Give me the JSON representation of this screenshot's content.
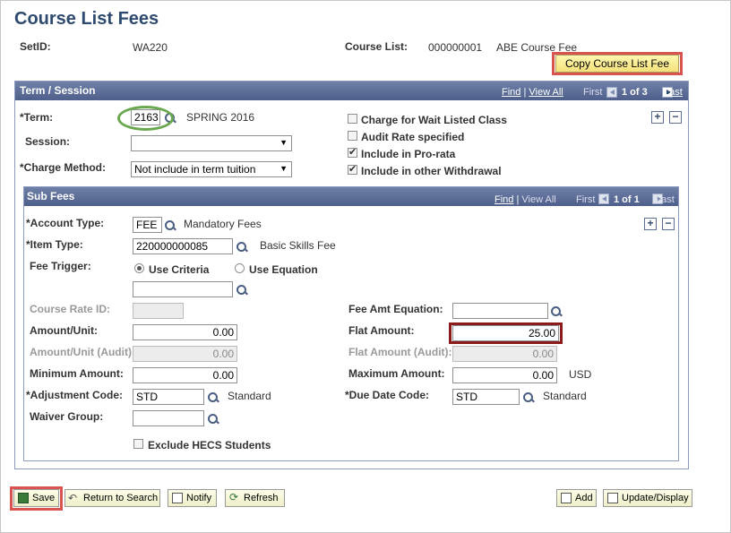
{
  "page": {
    "title": "Course List Fees",
    "setid_label": "SetID:",
    "setid_value": "WA220",
    "course_list_label": "Course List:",
    "course_list_code": "000000001",
    "course_list_desc": "ABE Course Fee",
    "copy_button": "Copy Course List Fee"
  },
  "term_session": {
    "header": "Term / Session",
    "find": "Find",
    "view_all": "View All",
    "first": "First",
    "counter": "1 of 3",
    "last": "Last",
    "term_label": "*Term:",
    "term_value": "2163",
    "term_desc": "SPRING 2016",
    "session_label": "Session:",
    "session_value": "",
    "charge_method_label": "*Charge Method:",
    "charge_method_value": "Not include in term tuition",
    "checkboxes": [
      {
        "label": "Charge for Wait Listed Class",
        "checked": false
      },
      {
        "label": "Audit Rate specified",
        "checked": false
      },
      {
        "label": "Include in Pro-rata",
        "checked": true
      },
      {
        "label": "Include in other Withdrawal",
        "checked": true
      }
    ]
  },
  "sub_fees": {
    "header": "Sub Fees",
    "find": "Find",
    "view_all": "View All",
    "first": "First",
    "counter": "1 of 1",
    "last": "Last",
    "account_type_label": "*Account Type:",
    "account_type_value": "FEE",
    "account_type_desc": "Mandatory Fees",
    "item_type_label": "*Item Type:",
    "item_type_value": "220000000085",
    "item_type_desc": "Basic Skills Fee",
    "fee_trigger_label": "Fee Trigger:",
    "use_criteria": "Use Criteria",
    "use_equation": "Use Equation",
    "course_rate_id_label": "Course Rate ID:",
    "fee_amt_equation_label": "Fee Amt Equation:",
    "amount_unit_label": "Amount/Unit:",
    "amount_unit_value": "0.00",
    "flat_amount_label": "Flat Amount:",
    "flat_amount_value": "25.00",
    "amount_unit_audit_label": "Amount/Unit (Audit):",
    "amount_unit_audit_value": "0.00",
    "flat_amount_audit_label": "Flat Amount (Audit):",
    "flat_amount_audit_value": "0.00",
    "minimum_amount_label": "Minimum Amount:",
    "minimum_amount_value": "0.00",
    "maximum_amount_label": "Maximum Amount:",
    "maximum_amount_value": "0.00",
    "currency": "USD",
    "adjustment_code_label": "*Adjustment Code:",
    "adjustment_code_value": "STD",
    "adjustment_code_desc": "Standard",
    "due_date_code_label": "*Due Date Code:",
    "due_date_code_value": "STD",
    "due_date_code_desc": "Standard",
    "waiver_group_label": "Waiver Group:",
    "exclude_hecs": "Exclude HECS Students"
  },
  "toolbar": {
    "save": "Save",
    "return_to_search": "Return to Search",
    "notify": "Notify",
    "refresh": "Refresh",
    "add": "Add",
    "update_display": "Update/Display"
  }
}
